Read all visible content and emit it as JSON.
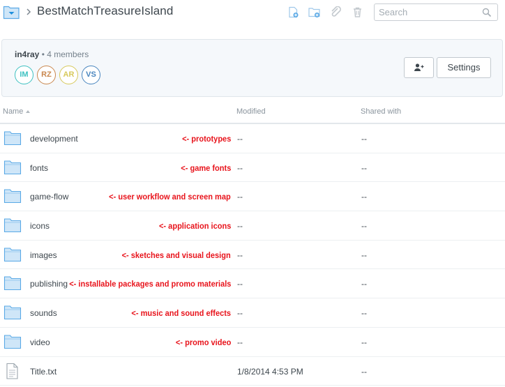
{
  "breadcrumb": {
    "title": "BestMatchTreasureIsland",
    "separator_icon": "chevron-right-icon"
  },
  "toolbar": {
    "icons": [
      "new-file-icon",
      "new-folder-icon",
      "share-link-icon",
      "trash-icon"
    ]
  },
  "search": {
    "placeholder": "Search",
    "value": ""
  },
  "team": {
    "name": "in4ray",
    "members_label": "• 4 members",
    "members": [
      {
        "initials": "IM",
        "color": "#3ec1c1"
      },
      {
        "initials": "RZ",
        "color": "#c9874e"
      },
      {
        "initials": "AR",
        "color": "#d7c95b"
      },
      {
        "initials": "VS",
        "color": "#4a86bf"
      }
    ],
    "settings_label": "Settings"
  },
  "columns": {
    "name": "Name",
    "modified": "Modified",
    "shared": "Shared with"
  },
  "files": [
    {
      "name": "development",
      "type": "folder",
      "note": "<- prototypes",
      "modified": "--",
      "shared": "--"
    },
    {
      "name": "fonts",
      "type": "folder",
      "note": "<- game fonts",
      "modified": "--",
      "shared": "--"
    },
    {
      "name": "game-flow",
      "type": "folder",
      "note": "<- user workflow and screen map",
      "modified": "--",
      "shared": "--"
    },
    {
      "name": "icons",
      "type": "folder",
      "note": "<- application icons",
      "modified": "--",
      "shared": "--"
    },
    {
      "name": "images",
      "type": "folder",
      "note": "<- sketches and visual design",
      "modified": "--",
      "shared": "--"
    },
    {
      "name": "publishing",
      "type": "folder",
      "note": "<- installable packages and promo materials",
      "modified": "--",
      "shared": "--"
    },
    {
      "name": "sounds",
      "type": "folder",
      "note": "<- music and sound effects",
      "modified": "--",
      "shared": "--"
    },
    {
      "name": "video",
      "type": "folder",
      "note": "<- promo video",
      "modified": "--",
      "shared": "--"
    },
    {
      "name": "Title.txt",
      "type": "file",
      "note": "",
      "modified": "1/8/2014 4:53 PM",
      "shared": "--"
    }
  ],
  "colors": {
    "accent": "#1e8fdd",
    "folder_fill": "#cfe6f8",
    "folder_stroke": "#5aa9e6",
    "annotation": "#e8141c"
  }
}
